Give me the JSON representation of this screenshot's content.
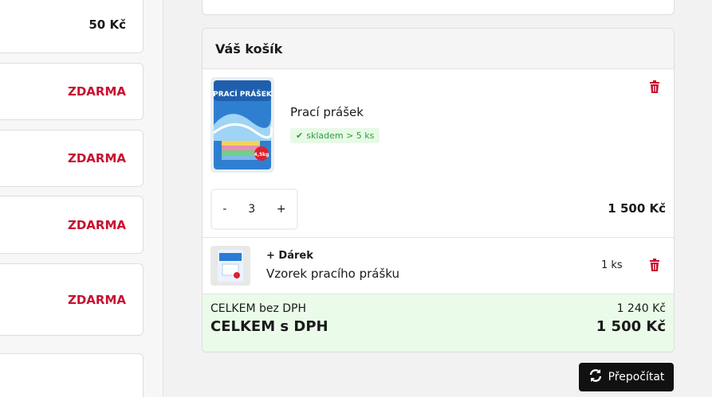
{
  "shipping": {
    "options": [
      {
        "price": "50 Kč",
        "free": false
      },
      {
        "price": "ZDARMA",
        "free": true
      },
      {
        "price": "ZDARMA",
        "free": true
      },
      {
        "price": "ZDARMA",
        "free": true
      },
      {
        "price": "ZDARMA",
        "free": true
      }
    ]
  },
  "cart": {
    "title": "Váš košík",
    "item": {
      "name": "Prací prášek",
      "stock": "skladem > 5 ks",
      "package_text": "PRACÍ PRÁŠEK",
      "weight": "4,5kg",
      "qty_minus": "-",
      "qty": "3",
      "qty_plus": "+",
      "price": "1 500 Kč"
    },
    "gift": {
      "label": "+ Dárek",
      "name": "Vzorek pracího prášku",
      "qty": "1 ks"
    },
    "totals": {
      "without_vat_label": "CELKEM bez DPH",
      "without_vat_value": "1 240 Kč",
      "with_vat_label": "CELKEM s DPH",
      "with_vat_value": "1 500 Kč"
    },
    "recalc_label": "Přepočítat"
  },
  "colors": {
    "accent_red": "#c8102e",
    "stock_green": "#2e9e3a",
    "totals_bg": "#eafbea",
    "button_bg": "#111111"
  }
}
